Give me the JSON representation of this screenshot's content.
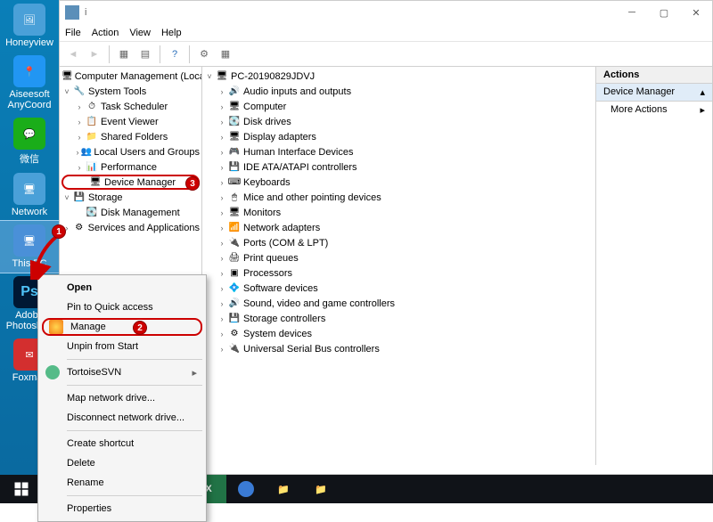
{
  "desktop": {
    "icons": [
      {
        "name": "honeyview",
        "label": "Honeyview"
      },
      {
        "name": "anycoord",
        "label": "Aiseesoft AnyCoord"
      },
      {
        "name": "wechat",
        "label": "微信"
      },
      {
        "name": "network",
        "label": "Network"
      },
      {
        "name": "this-pc",
        "label": "This PC"
      },
      {
        "name": "photoshop",
        "label": "Adobe Photoshop"
      },
      {
        "name": "foxmail",
        "label": "Foxmail"
      }
    ]
  },
  "window": {
    "title": "i",
    "menu": {
      "file": "File",
      "action": "Action",
      "view": "View",
      "help": "Help"
    }
  },
  "left_tree": {
    "root": "Computer Management (Local",
    "system_tools": "System Tools",
    "task_scheduler": "Task Scheduler",
    "event_viewer": "Event Viewer",
    "shared_folders": "Shared Folders",
    "local_users": "Local Users and Groups",
    "performance": "Performance",
    "device_manager": "Device Manager",
    "storage": "Storage",
    "disk_management": "Disk Management",
    "services": "Services and Applications"
  },
  "mid_tree": {
    "root": "PC-20190829JDVJ",
    "items": [
      "Audio inputs and outputs",
      "Computer",
      "Disk drives",
      "Display adapters",
      "Human Interface Devices",
      "IDE ATA/ATAPI controllers",
      "Keyboards",
      "Mice and other pointing devices",
      "Monitors",
      "Network adapters",
      "Ports (COM & LPT)",
      "Print queues",
      "Processors",
      "Software devices",
      "Sound, video and game controllers",
      "Storage controllers",
      "System devices",
      "Universal Serial Bus controllers"
    ]
  },
  "actions": {
    "header": "Actions",
    "section": "Device Manager",
    "more": "More Actions"
  },
  "context_menu": {
    "open": "Open",
    "pin": "Pin to Quick access",
    "manage": "Manage",
    "unpin": "Unpin from Start",
    "tortoise": "TortoiseSVN",
    "map": "Map network drive...",
    "disconnect": "Disconnect network drive...",
    "shortcut": "Create shortcut",
    "delete": "Delete",
    "rename": "Rename",
    "properties": "Properties"
  },
  "badges": {
    "b1": "1",
    "b2": "2",
    "b3": "3"
  }
}
